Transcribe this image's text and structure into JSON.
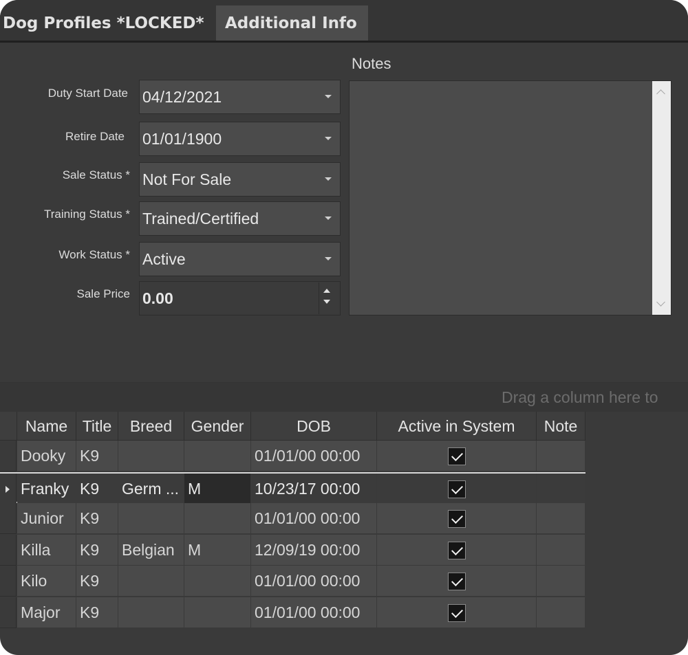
{
  "tabs": [
    {
      "label": "Dog Profiles *LOCKED*"
    },
    {
      "label": "Additional Info"
    }
  ],
  "form": {
    "duty_start_date": {
      "label": "Duty Start Date",
      "value": "04/12/2021"
    },
    "retire_date": {
      "label": "Retire Date",
      "value": "01/01/1900"
    },
    "sale_status": {
      "label": "Sale Status *",
      "value": "Not For Sale"
    },
    "training_status": {
      "label": "Training Status *",
      "value": "Trained/Certified"
    },
    "work_status": {
      "label": "Work Status *",
      "value": "Active"
    },
    "sale_price": {
      "label": "Sale Price",
      "value": "0.00"
    },
    "notes": {
      "label": "Notes",
      "value": ""
    }
  },
  "grid": {
    "group_hint": "Drag a column here to",
    "columns": [
      "Name",
      "Title",
      "Breed",
      "Gender",
      "DOB",
      "Active in System",
      "Note"
    ],
    "rows": [
      {
        "name": "Dooky",
        "title": "K9",
        "breed": "",
        "gender": "",
        "dob": "01/01/00 00:00",
        "active": true,
        "note": ""
      },
      {
        "name": "Franky",
        "title": "K9",
        "breed": "Germ ...",
        "gender": "M",
        "dob": "10/23/17 00:00",
        "active": true,
        "note": ""
      },
      {
        "name": "Junior",
        "title": "K9",
        "breed": "",
        "gender": "",
        "dob": "01/01/00 00:00",
        "active": true,
        "note": ""
      },
      {
        "name": "Killa",
        "title": "K9",
        "breed": "Belgian",
        "gender": "M",
        "dob": "12/09/19 00:00",
        "active": true,
        "note": ""
      },
      {
        "name": "Kilo",
        "title": "K9",
        "breed": "",
        "gender": "",
        "dob": "01/01/00 00:00",
        "active": true,
        "note": ""
      },
      {
        "name": "Major",
        "title": "K9",
        "breed": "",
        "gender": "",
        "dob": "01/01/00 00:00",
        "active": true,
        "note": ""
      }
    ],
    "selected_row": 1
  }
}
